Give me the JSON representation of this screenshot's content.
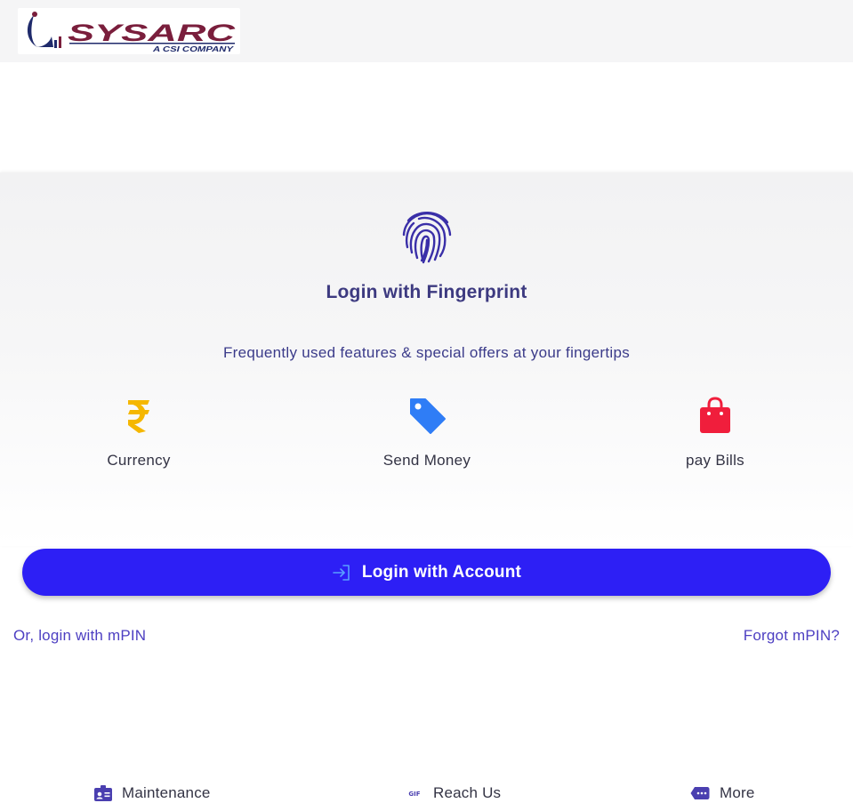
{
  "brand": {
    "logo_text": "SYSARC",
    "logo_tagline": "A CSI COMPANY",
    "colors": {
      "primary": "#2d1ff5",
      "accent_dark": "#3d3a80",
      "brand_red": "#7a1e3c",
      "brand_navy": "#1f2a6b"
    }
  },
  "fingerprint": {
    "icon": "fingerprint-icon",
    "title": "Login with Fingerprint",
    "subtitle": "Frequently used features & special offers at your fingertips"
  },
  "features": [
    {
      "label": "Currency",
      "icon": "rupee-icon",
      "color": "#f5b700"
    },
    {
      "label": "Send Money",
      "icon": "tag-icon",
      "color": "#2f7df6"
    },
    {
      "label": "pay Bills",
      "icon": "shopping-bag-icon",
      "color": "#f01e3c"
    }
  ],
  "login_button": {
    "label": "Login with Account",
    "icon": "login-icon"
  },
  "links": {
    "mpin": "Or, login with mPIN",
    "forgot": "Forgot mPIN?"
  },
  "footer": [
    {
      "label": "Maintenance",
      "icon": "id-badge-icon",
      "color": "#4a3fb0"
    },
    {
      "label": "Reach Us",
      "icon": "gif-icon",
      "color": "#4a3fb0"
    },
    {
      "label": "More",
      "icon": "message-dots-icon",
      "color": "#4a3fb0"
    }
  ]
}
